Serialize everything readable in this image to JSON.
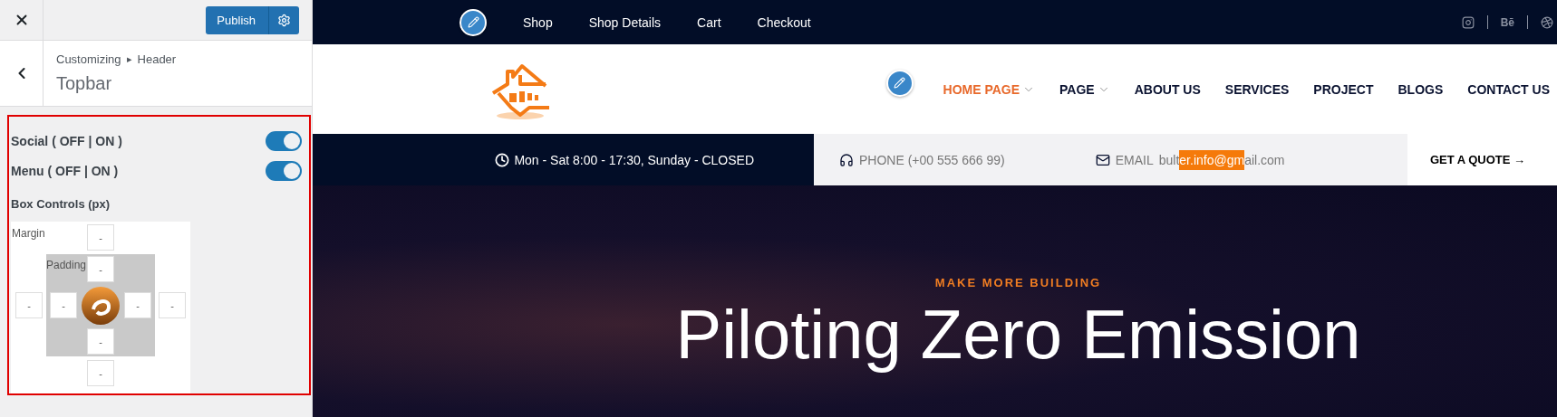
{
  "customizer": {
    "publish_label": "Publish",
    "breadcrumb": {
      "root": "Customizing",
      "separator": "▸",
      "section": "Header"
    },
    "title": "Topbar",
    "toggles": [
      {
        "label": "Social ( OFF | ON )",
        "on": true
      },
      {
        "label": "Menu ( OFF | ON )",
        "on": true
      }
    ],
    "box_controls": {
      "title": "Box Controls (px)",
      "margin": {
        "label": "Margin",
        "top": "-",
        "right": "-",
        "bottom": "-",
        "left": "-"
      },
      "padding": {
        "label": "Padding",
        "top": "-",
        "right": "-",
        "bottom": "-",
        "left": "-"
      }
    }
  },
  "site": {
    "behance_label": "Bē",
    "top_nav": [
      "Shop",
      "Shop Details",
      "Cart",
      "Checkout"
    ],
    "main_menu": [
      {
        "label": "HOME PAGE",
        "selected": true,
        "dropdown": true
      },
      {
        "label": "PAGE",
        "selected": false,
        "dropdown": true
      },
      {
        "label": "ABOUT US",
        "selected": false,
        "dropdown": false
      },
      {
        "label": "SERVICES",
        "selected": false,
        "dropdown": false
      },
      {
        "label": "PROJECT",
        "selected": false,
        "dropdown": false
      },
      {
        "label": "BLOGS",
        "selected": false,
        "dropdown": false
      },
      {
        "label": "CONTACT US",
        "selected": false,
        "dropdown": false
      }
    ],
    "topbar": {
      "hours": "Mon - Sat 8:00 - 17:30, Sunday - CLOSED",
      "phone": "PHONE (+00 555 666 99)",
      "email_label": "EMAIL",
      "email_parts": [
        {
          "text": "bult",
          "selected": false
        },
        {
          "text": "er.info@gm",
          "selected": true
        },
        {
          "text": "ail.com",
          "selected": false
        }
      ],
      "cta": "GET A QUOTE →"
    },
    "hero": {
      "eyebrow": "MAKE MORE BUILDING",
      "title": "Piloting Zero Emission"
    }
  }
}
